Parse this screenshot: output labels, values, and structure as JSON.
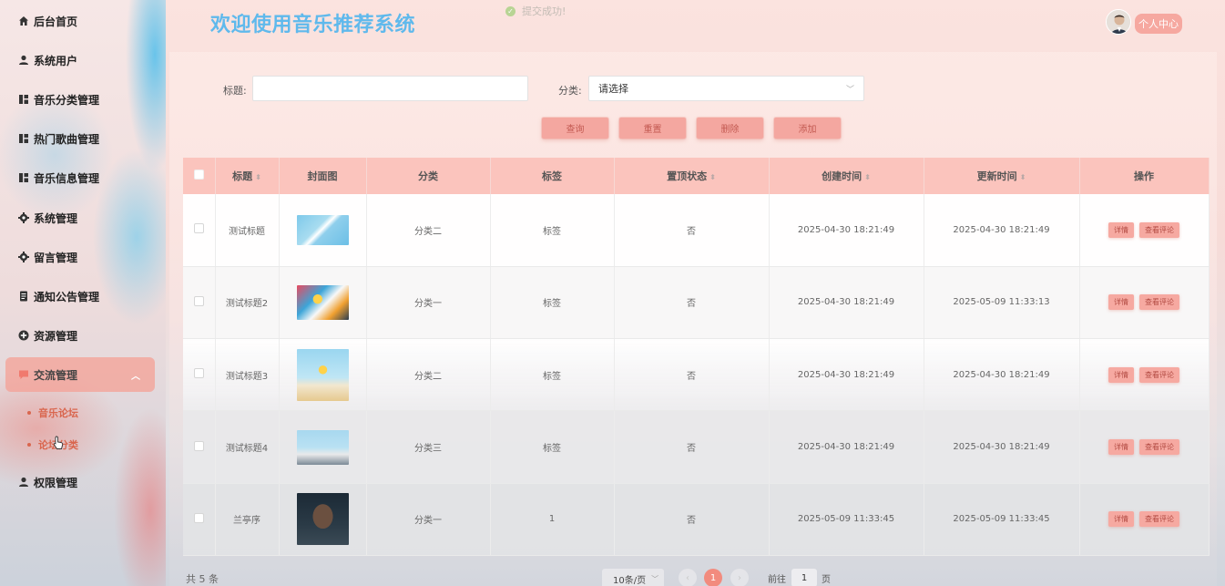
{
  "header": {
    "title": "欢迎使用音乐推荐系统",
    "toast": "提交成功!",
    "user_center": "个人中心"
  },
  "sidebar": {
    "items": [
      {
        "label": "后台首页",
        "icon": "home-icon"
      },
      {
        "label": "系统用户",
        "icon": "user-icon"
      },
      {
        "label": "音乐分类管理",
        "icon": "grid-icon"
      },
      {
        "label": "热门歌曲管理",
        "icon": "grid-icon"
      },
      {
        "label": "音乐信息管理",
        "icon": "grid-icon"
      },
      {
        "label": "系统管理",
        "icon": "gear-icon"
      },
      {
        "label": "留言管理",
        "icon": "gear-icon"
      },
      {
        "label": "通知公告管理",
        "icon": "document-icon"
      },
      {
        "label": "资源管理",
        "icon": "plus-circle-icon"
      },
      {
        "label": "交流管理",
        "icon": "chat-icon"
      },
      {
        "label": "权限管理",
        "icon": "user-icon"
      }
    ],
    "submenu": [
      {
        "label": "音乐论坛"
      },
      {
        "label": "论坛分类"
      }
    ]
  },
  "search": {
    "title_label": "标题:",
    "title_value": "",
    "category_label": "分类:",
    "category_placeholder": "请选择"
  },
  "actions": {
    "query": "查询",
    "reset": "重置",
    "delete": "删除",
    "add": "添加"
  },
  "table": {
    "headers": {
      "title": "标题",
      "cover": "封面图",
      "category": "分类",
      "tag": "标签",
      "pinned": "置顶状态",
      "created": "创建时间",
      "updated": "更新时间",
      "operation": "操作"
    },
    "rows": [
      {
        "title": "测试标题",
        "category": "分类二",
        "tag": "标签",
        "pinned": "否",
        "created": "2025-04-30 18:21:49",
        "updated": "2025-04-30 18:21:49"
      },
      {
        "title": "测试标题2",
        "category": "分类一",
        "tag": "标签",
        "pinned": "否",
        "created": "2025-04-30 18:21:49",
        "updated": "2025-05-09 11:33:13"
      },
      {
        "title": "测试标题3",
        "category": "分类二",
        "tag": "标签",
        "pinned": "否",
        "created": "2025-04-30 18:21:49",
        "updated": "2025-04-30 18:21:49"
      },
      {
        "title": "测试标题4",
        "category": "分类三",
        "tag": "标签",
        "pinned": "否",
        "created": "2025-04-30 18:21:49",
        "updated": "2025-04-30 18:21:49"
      },
      {
        "title": "兰亭序",
        "category": "分类一",
        "tag": "1",
        "pinned": "否",
        "created": "2025-05-09 11:33:45",
        "updated": "2025-05-09 11:33:45"
      }
    ],
    "row_actions": {
      "detail": "详情",
      "comments": "查看评论"
    }
  },
  "pagination": {
    "total": "共 5 条",
    "page_size": "10条/页",
    "current_page": "1",
    "goto_prefix": "前往",
    "goto_value": "1",
    "goto_suffix": "页"
  },
  "colors": {
    "accent": "#f4a7a0",
    "title_blue": "#5fb9ec",
    "active_menu": "#d9664e",
    "header_row": "#fbc4bd"
  }
}
